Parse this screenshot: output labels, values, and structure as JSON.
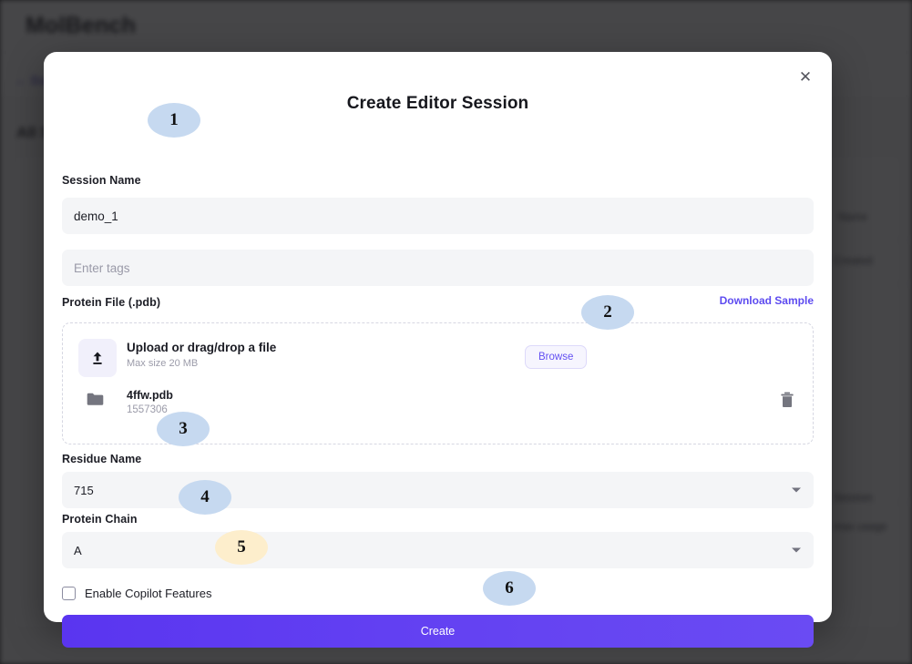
{
  "background": {
    "brand": "MolBench",
    "back_label": "← Back",
    "section_title": "All Sessions",
    "cells": [
      "Name",
      "Created",
      "Session",
      "max usage"
    ]
  },
  "modal": {
    "title": "Create Editor Session",
    "close_icon": "close-icon",
    "session_name_label": "Session Name",
    "session_name_value": "demo_1",
    "tags_placeholder": "Enter tags",
    "protein_file_label": "Protein File (.pdb)",
    "download_sample_label": "Download Sample",
    "upload": {
      "icon": "upload-icon",
      "title": "Upload or drag/drop a file",
      "subtitle": "Max size 20 MB",
      "browse_label": "Browse",
      "file_icon": "folder-icon",
      "file_name": "4ffw.pdb",
      "file_size": "1557306",
      "delete_icon": "trash-icon"
    },
    "residue_name_label": "Residue Name",
    "residue_name_value": "715",
    "protein_chain_label": "Protein Chain",
    "protein_chain_value": "A",
    "copilot_label": "Enable Copilot Features",
    "copilot_checked": false,
    "create_label": "Create"
  },
  "callouts": [
    {
      "number": "1",
      "color": "#c6d9f0"
    },
    {
      "number": "2",
      "color": "#c6d9f0"
    },
    {
      "number": "3",
      "color": "#c6d9f0"
    },
    {
      "number": "4",
      "color": "#c6d9f0"
    },
    {
      "number": "5",
      "color": "#fdeecc"
    },
    {
      "number": "6",
      "color": "#c6d9f0"
    }
  ],
  "colors": {
    "accent": "#5d4bf0",
    "surface": "#ffffff",
    "input_bg": "#f4f5f7",
    "overlay": "rgba(24,24,26,0.80)"
  }
}
